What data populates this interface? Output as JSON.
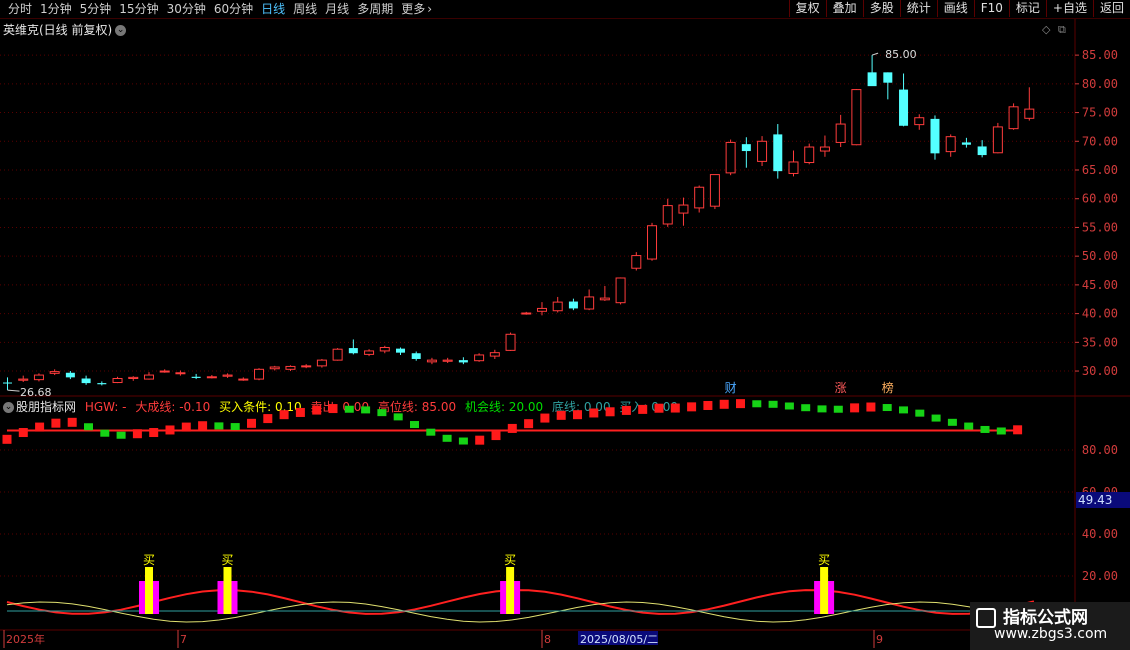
{
  "toolbar": {
    "periods": [
      "分时",
      "1分钟",
      "5分钟",
      "15分钟",
      "30分钟",
      "60分钟",
      "日线",
      "周线",
      "月线",
      "多周期",
      "更多"
    ],
    "active_period": "日线",
    "more_chevron": "chevron-right-icon",
    "actions": [
      "复权",
      "叠加",
      "多股",
      "统计",
      "画线",
      "F10",
      "标记",
      "+自选",
      "返回"
    ]
  },
  "chart": {
    "title": "英维克(日线 前复权)",
    "high_label": "85.00",
    "low_label": "26.68",
    "event_tags": [
      "财",
      "涨",
      "榜"
    ],
    "colors": {
      "up": "#ff3c3c",
      "down": "#54ffff",
      "grid": "#5a0000",
      "axis_text": "#d23c3c"
    }
  },
  "indicator": {
    "name": "股朋指标网",
    "items": [
      {
        "label": "HGW: -",
        "color": "#ff3c3c"
      },
      {
        "label": "大成线: -0.10",
        "color": "#ff3c3c"
      },
      {
        "label": "买入条件: 0.10",
        "color": "#ffff00"
      },
      {
        "label": "卖出: 0.00",
        "color": "#ff3c3c"
      },
      {
        "label": "高位线: 85.00",
        "color": "#ff3c3c"
      },
      {
        "label": "机会线: 20.00",
        "color": "#00dd00"
      },
      {
        "label": "底线: 0.00",
        "color": "#2fa0a0"
      },
      {
        "label": "买入: 0.00",
        "color": "#2fa0a0"
      }
    ],
    "buy_label": "买",
    "current_value": "49.43"
  },
  "chart_data": [
    {
      "type": "candlestick",
      "title": "英维克(日线 前复权)",
      "y_ticks": [
        30,
        35,
        40,
        45,
        50,
        55,
        60,
        65,
        70,
        75,
        80,
        85
      ],
      "ylim": [
        25.5,
        87.5
      ],
      "ohlc": [
        [
          28.0,
          28.9,
          26.68,
          27.9
        ],
        [
          28.4,
          29.2,
          28.1,
          28.6
        ],
        [
          28.5,
          29.6,
          28.2,
          29.3
        ],
        [
          29.6,
          30.3,
          29.3,
          29.9
        ],
        [
          29.7,
          30.0,
          28.6,
          28.9
        ],
        [
          28.7,
          29.2,
          27.6,
          27.9
        ],
        [
          27.9,
          28.2,
          27.5,
          27.7
        ],
        [
          28.0,
          29.0,
          27.9,
          28.7
        ],
        [
          28.7,
          29.1,
          28.3,
          28.9
        ],
        [
          28.6,
          29.8,
          28.5,
          29.3
        ],
        [
          29.9,
          30.3,
          29.7,
          30.0
        ],
        [
          29.6,
          30.1,
          29.2,
          29.7
        ],
        [
          29.0,
          29.5,
          28.6,
          28.8
        ],
        [
          29.0,
          29.3,
          28.7,
          29.0
        ],
        [
          29.1,
          29.6,
          28.8,
          29.3
        ],
        [
          28.5,
          28.9,
          28.3,
          28.6
        ],
        [
          28.6,
          30.5,
          28.4,
          30.3
        ],
        [
          30.4,
          30.9,
          30.1,
          30.7
        ],
        [
          30.3,
          31.0,
          30.0,
          30.8
        ],
        [
          30.8,
          31.2,
          30.5,
          30.9
        ],
        [
          30.9,
          32.1,
          30.6,
          31.9
        ],
        [
          31.9,
          34.0,
          31.8,
          33.8
        ],
        [
          34.0,
          35.5,
          32.9,
          33.1
        ],
        [
          32.9,
          33.8,
          32.6,
          33.5
        ],
        [
          33.5,
          34.4,
          33.1,
          34.1
        ],
        [
          33.9,
          34.1,
          32.8,
          33.2
        ],
        [
          33.1,
          33.4,
          31.8,
          32.1
        ],
        [
          31.6,
          32.3,
          31.2,
          31.9
        ],
        [
          31.7,
          32.3,
          31.4,
          31.9
        ],
        [
          31.9,
          32.4,
          31.2,
          31.5
        ],
        [
          31.8,
          33.1,
          31.6,
          32.8
        ],
        [
          32.6,
          33.7,
          32.1,
          33.2
        ],
        [
          33.6,
          36.7,
          33.5,
          36.4
        ],
        [
          40.0,
          40.3,
          39.8,
          40.1
        ],
        [
          40.4,
          42.0,
          39.7,
          40.9
        ],
        [
          40.5,
          42.9,
          40.2,
          42.0
        ],
        [
          42.1,
          42.6,
          40.6,
          40.9
        ],
        [
          40.8,
          44.2,
          40.6,
          42.9
        ],
        [
          42.4,
          44.8,
          42.2,
          42.7
        ],
        [
          41.9,
          46.3,
          41.6,
          46.2
        ],
        [
          47.9,
          50.7,
          47.5,
          50.1
        ],
        [
          49.5,
          55.8,
          49.2,
          55.3
        ],
        [
          55.6,
          60.0,
          55.1,
          58.8
        ],
        [
          57.5,
          60.2,
          55.3,
          58.9
        ],
        [
          58.4,
          62.3,
          57.6,
          62.0
        ],
        [
          58.7,
          64.0,
          58.2,
          64.2
        ],
        [
          64.5,
          70.3,
          64.1,
          69.8
        ],
        [
          69.5,
          70.7,
          65.4,
          68.3
        ],
        [
          66.5,
          70.9,
          65.7,
          70.0
        ],
        [
          71.2,
          73.0,
          63.5,
          64.8
        ],
        [
          64.4,
          68.4,
          63.9,
          66.4
        ],
        [
          66.3,
          69.6,
          66.0,
          69.0
        ],
        [
          68.3,
          71.0,
          67.3,
          69.0
        ],
        [
          69.8,
          74.6,
          69.0,
          73.0
        ],
        [
          69.4,
          79.1,
          69.3,
          79.0
        ],
        [
          82.0,
          85.0,
          79.7,
          79.6
        ],
        [
          82.0,
          82.0,
          77.3,
          80.2
        ],
        [
          79.0,
          81.8,
          72.6,
          72.7
        ],
        [
          72.9,
          74.7,
          72.0,
          74.1
        ],
        [
          73.9,
          74.5,
          66.8,
          67.9
        ],
        [
          68.2,
          71.2,
          67.3,
          70.8
        ],
        [
          69.8,
          70.6,
          68.9,
          69.4
        ],
        [
          69.1,
          70.2,
          67.2,
          67.6
        ],
        [
          68.0,
          73.2,
          67.9,
          72.5
        ],
        [
          72.2,
          76.6,
          72.0,
          76.0
        ],
        [
          74.0,
          79.4,
          73.6,
          75.6
        ]
      ],
      "events": [
        {
          "index": 46,
          "label": "财"
        },
        {
          "index": 53,
          "label": "涨"
        },
        {
          "index": 56,
          "label": "榜"
        }
      ]
    },
    {
      "type": "bar",
      "title": "股朋指标网",
      "y_ticks": [
        20,
        40,
        60,
        80
      ],
      "ylim": [
        0,
        100
      ],
      "series": [
        {
          "name": "大成线",
          "values": [
            73.4,
            77.4,
            80.6,
            82.9,
            83.4,
            80.8,
            77.0,
            75.8,
            76.7,
            77.4,
            78.9,
            80.6,
            81.4,
            81.3,
            80.9,
            82.8,
            85.6,
            87.9,
            89.2,
            90.6,
            91.5,
            91.1,
            90.7,
            89.1,
            86.6,
            82.1,
            77.6,
            74.0,
            72.4,
            72.9,
            75.6,
            79.8,
            82.6,
            85.9,
            87.5,
            87.9,
            88.9,
            89.6,
            90.4,
            91.0,
            91.7,
            91.8,
            92.5,
            93.3,
            94.0,
            94.4,
            94.3,
            94.0,
            93.0,
            92.0,
            91.3,
            91.1,
            91.9,
            92.4,
            92.1,
            90.7,
            88.8,
            85.9,
            83.4,
            81.2,
            79.2,
            78.3,
            79.0
          ]
        },
        {
          "name": "高位线",
          "values": [
            85
          ]
        },
        {
          "name": "机会线",
          "values": [
            20
          ]
        }
      ],
      "buy_signals": [
        9,
        14,
        32,
        52
      ],
      "current_value": 49.43
    }
  ],
  "x_axis": {
    "labels": [
      "2025年",
      "7",
      "8",
      "2025/08/05/二",
      "9"
    ]
  },
  "watermark": {
    "site": "指标公式网",
    "url": "www.zbgs3.com"
  }
}
